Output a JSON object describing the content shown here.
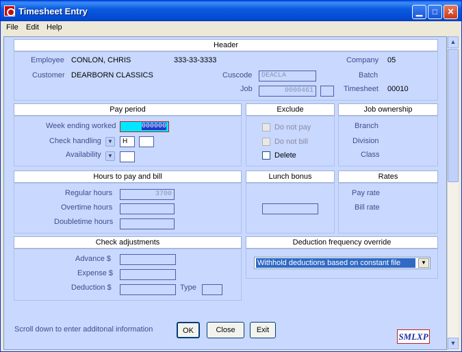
{
  "window": {
    "title": "Timesheet Entry"
  },
  "menu": [
    "File",
    "Edit",
    "Help"
  ],
  "header": {
    "title": "Header",
    "employee_label": "Employee",
    "employee_name": "CONLON, CHRIS",
    "employee_ssn": "333-33-3333",
    "company_label": "Company",
    "company_value": "05",
    "customer_label": "Customer",
    "customer_name": "DEARBORN CLASSICS",
    "cuscode_label": "Cuscode",
    "cuscode_value": "DEACLA",
    "batch_label": "Batch",
    "job_label": "Job",
    "job_value": "0000461",
    "timesheet_label": "Timesheet",
    "timesheet_value": "00010"
  },
  "pay_period": {
    "title": "Pay period",
    "week_label": "Week ending worked",
    "week_value": "000000",
    "check_label": "Check handling",
    "check_value": "H",
    "availability_label": "Availability"
  },
  "exclude": {
    "title": "Exclude",
    "items": [
      {
        "label": "Do not pay",
        "disabled": true
      },
      {
        "label": "Do not bill",
        "disabled": true
      },
      {
        "label": "Delete",
        "disabled": false
      }
    ]
  },
  "job_ownership": {
    "title": "Job ownership",
    "branch": "Branch",
    "division": "Division",
    "class": "Class"
  },
  "hours": {
    "title": "Hours to pay and bill",
    "regular_label": "Regular hours",
    "regular_value": "3700",
    "overtime_label": "Overtime hours",
    "doubletime_label": "Doubletime hours"
  },
  "lunch": {
    "title": "Lunch bonus"
  },
  "rates": {
    "title": "Rates",
    "pay_rate": "Pay rate",
    "bill_rate": "Bill rate"
  },
  "check_adj": {
    "title": "Check adjustments",
    "advance": "Advance $",
    "expense": "Expense $",
    "deduction": "Deduction $",
    "type": "Type"
  },
  "deduction_freq": {
    "title": "Deduction frequency override",
    "selected": "Withhold deductions based on constant file"
  },
  "footer": {
    "hint": "Scroll down to enter additonal information",
    "ok": "OK",
    "close": "Close",
    "exit": "Exit",
    "logo": "SMLXP"
  }
}
